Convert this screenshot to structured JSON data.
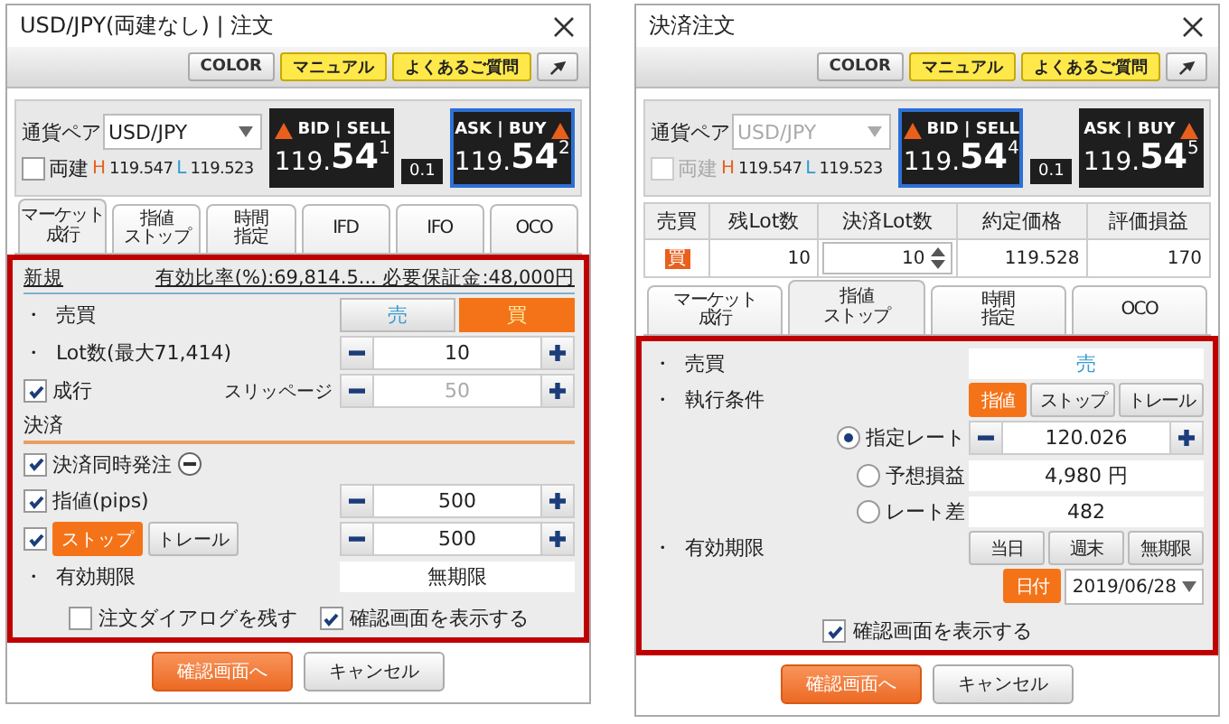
{
  "windows": [
    {
      "title": "USD/JPY(両建なし) | 注文",
      "toolbar": [
        {
          "label": "COLOR",
          "kind": "plain"
        },
        {
          "label": "マニュアル",
          "kind": "yellow"
        },
        {
          "label": "よくあるご質問",
          "kind": "yellow"
        }
      ],
      "quote": {
        "pair_label": "通貨ペア",
        "pair": "USD/JPY",
        "pair_disabled": false,
        "hedge_label": "両建",
        "hedge_checked": false,
        "hedge_disabled": false,
        "high_label": "H",
        "high": "119.547",
        "low_label": "L",
        "low": "119.523",
        "bid": {
          "label": "BID | SELL",
          "head": "119.",
          "big": "54",
          "pip": "1",
          "selected": false
        },
        "spread": "0.1",
        "ask": {
          "label": "ASK | BUY",
          "head": "119.",
          "big": "54",
          "pip": "2",
          "selected": true
        }
      },
      "tabs": [
        {
          "lines": [
            "マーケット",
            "成行"
          ],
          "selected": true
        },
        {
          "lines": [
            "指値",
            "ストップ"
          ],
          "selected": false
        },
        {
          "lines": [
            "時間",
            "指定"
          ],
          "selected": false
        },
        {
          "lines": [
            "IFD"
          ],
          "selected": false
        },
        {
          "lines": [
            "IFO"
          ],
          "selected": false
        },
        {
          "lines": [
            "OCO"
          ],
          "selected": false
        }
      ],
      "highlighted": true,
      "rows": [
        {
          "kind": "header",
          "label": "新規",
          "info": "有効比率(%):69,814.5... 必要保証金:48,000円"
        },
        {
          "kind": "toggle",
          "label": "・  売買",
          "options": [
            {
              "label": "売",
              "selected": false
            },
            {
              "label": "買",
              "selected": true
            }
          ]
        },
        {
          "kind": "stepper",
          "label": "・  Lot数(最大71,414)",
          "value": "10",
          "disabled": false
        },
        {
          "kind": "stepper",
          "label": "成行",
          "checked": true,
          "sublabel": "スリッページ",
          "value": "50",
          "disabled": true
        },
        {
          "kind": "section",
          "label": "決済"
        },
        {
          "kind": "check",
          "label": "決済同時発注",
          "checked": true,
          "expanded": true
        },
        {
          "kind": "stepper",
          "label": "指値(pips)",
          "checked": true,
          "value": "500",
          "disabled": false
        },
        {
          "kind": "stepper",
          "checked": true,
          "options": [
            {
              "label": "ストップ",
              "selected": true
            },
            {
              "label": "トレール",
              "selected": false
            }
          ],
          "value": "500",
          "disabled": false
        },
        {
          "kind": "value",
          "label": "・  有効期限",
          "value": "無期限"
        }
      ],
      "checks": [
        {
          "label": "注文ダイアログを残す",
          "checked": false
        },
        {
          "label": "確認画面を表示する",
          "checked": true
        }
      ],
      "buttons": [
        {
          "label": "確認画面へ",
          "kind": "primary"
        },
        {
          "label": "キャンセル",
          "kind": "secondary"
        }
      ]
    },
    {
      "title": "決済注文",
      "toolbar": [
        {
          "label": "COLOR",
          "kind": "plain"
        },
        {
          "label": "マニュアル",
          "kind": "yellow"
        },
        {
          "label": "よくあるご質問",
          "kind": "yellow"
        }
      ],
      "quote": {
        "pair_label": "通貨ペア",
        "pair": "USD/JPY",
        "pair_disabled": true,
        "hedge_label": "両建",
        "hedge_checked": false,
        "hedge_disabled": true,
        "high_label": "H",
        "high": "119.547",
        "low_label": "L",
        "low": "119.523",
        "bid": {
          "label": "BID | SELL",
          "head": "119.",
          "big": "54",
          "pip": "4",
          "selected": true
        },
        "spread": "0.1",
        "ask": {
          "label": "ASK | BUY",
          "head": "119.",
          "big": "54",
          "pip": "5",
          "selected": false
        }
      },
      "positions": {
        "columns": [
          "売買",
          "残Lot数",
          "決済Lot数",
          "約定価格",
          "評価損益"
        ],
        "rows": [
          {
            "side": "買",
            "remaining": "10",
            "settle": "10",
            "price": "119.528",
            "pl": "170"
          }
        ]
      },
      "tabs": [
        {
          "lines": [
            "マーケット",
            "成行"
          ],
          "selected": false
        },
        {
          "lines": [
            "指値",
            "ストップ"
          ],
          "selected": true
        },
        {
          "lines": [
            "時間",
            "指定"
          ],
          "selected": false
        },
        {
          "lines": [
            "OCO"
          ],
          "selected": false
        }
      ],
      "highlighted": true,
      "rows": [
        {
          "kind": "side_value",
          "label": "・  売買",
          "value": "売"
        },
        {
          "kind": "options",
          "label": "・  執行条件",
          "options": [
            {
              "label": "指値",
              "selected": true
            },
            {
              "label": "ストップ",
              "selected": false
            },
            {
              "label": "トレール",
              "selected": false
            }
          ]
        },
        {
          "kind": "radio",
          "label": "指定レート",
          "selected": true,
          "value": "120.026",
          "stepper": true
        },
        {
          "kind": "radio",
          "label": "予想損益",
          "selected": false,
          "value": "4,980 円"
        },
        {
          "kind": "radio",
          "label": "レート差",
          "selected": false,
          "value": "482"
        },
        {
          "kind": "options",
          "label": "・  有効期限",
          "options": [
            {
              "label": "当日",
              "selected": false
            },
            {
              "label": "週末",
              "selected": false
            },
            {
              "label": "無期限",
              "selected": false
            }
          ]
        },
        {
          "kind": "date",
          "options": [
            {
              "label": "日付",
              "selected": true
            }
          ],
          "value": "2019/06/28"
        }
      ],
      "checks": [
        {
          "label": "確認画面を表示する",
          "checked": true
        }
      ],
      "buttons": [
        {
          "label": "確認画面へ",
          "kind": "primary"
        },
        {
          "label": "キャンセル",
          "kind": "secondary"
        }
      ]
    }
  ]
}
